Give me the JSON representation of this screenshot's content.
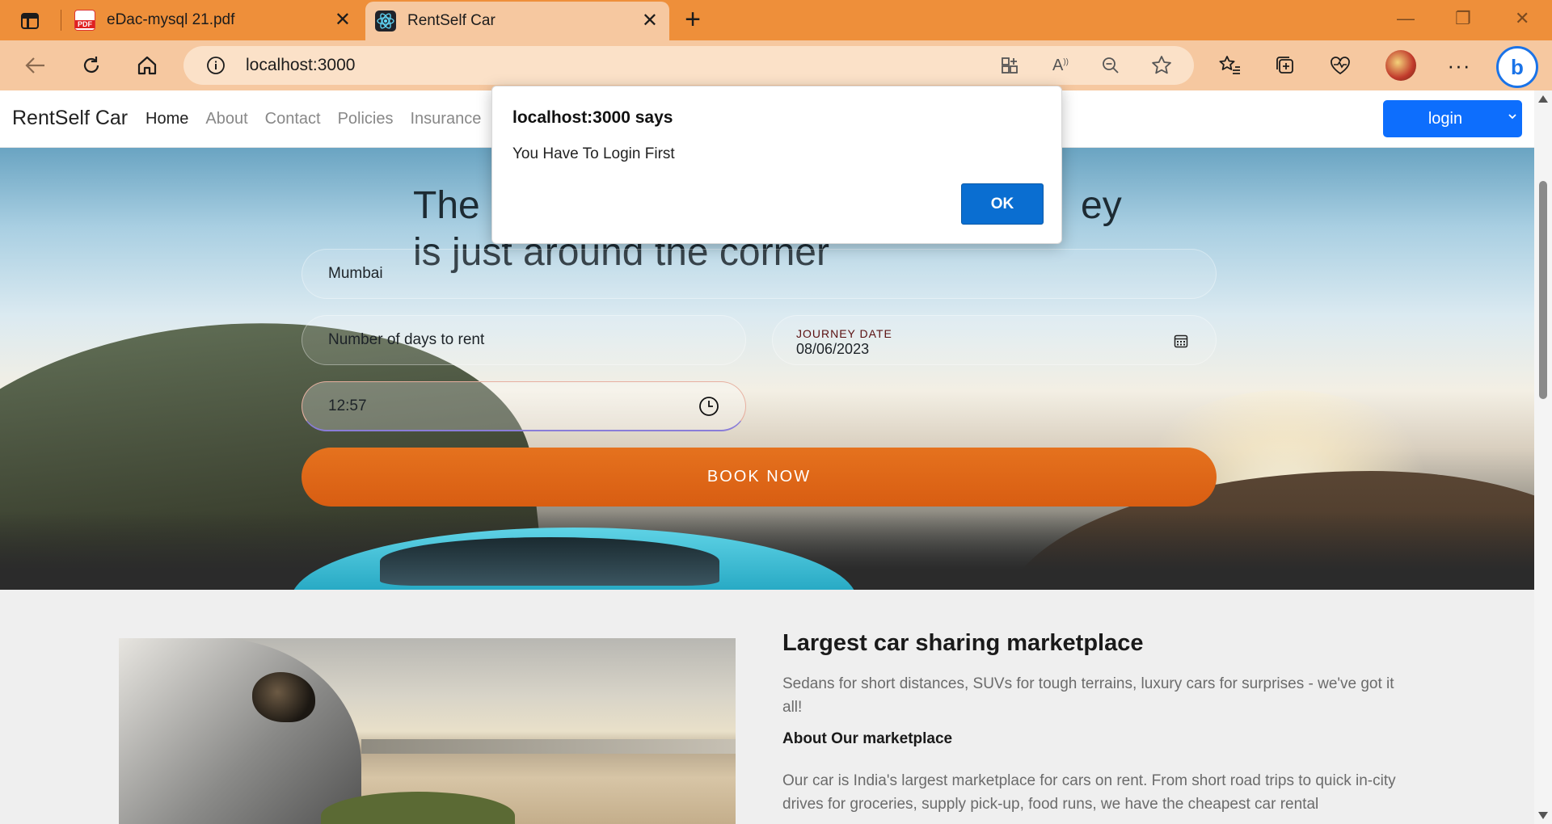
{
  "browser": {
    "tabs": [
      {
        "title": "eDac-mysql 21.pdf",
        "favicon": "pdf-icon",
        "active": false
      },
      {
        "title": "RentSelf Car",
        "favicon": "react-icon",
        "active": true
      }
    ],
    "address": "localhost:3000",
    "accent": "#ee8f3a",
    "toolbar_color": "#f6c8a0"
  },
  "site": {
    "brand": "RentSelf Car",
    "nav": [
      "Home",
      "About",
      "Contact",
      "Policies",
      "Insurance"
    ],
    "active_nav": "Home",
    "login_label": "login",
    "login_color": "#0d6efd"
  },
  "hero": {
    "title_line1": "The",
    "title_line1_tail": "ey",
    "title_line2": "is just around the corner",
    "city_value": "Mumbai",
    "days_placeholder": "Number of days to rent",
    "date_caption": "JOURNEY DATE",
    "date_value": "08/06/2023",
    "time_value": "12:57",
    "book_label": "BOOK NOW",
    "book_color": "#e06a18"
  },
  "marketplace": {
    "title": "Largest car sharing marketplace",
    "description": "Sedans for short distances, SUVs for tough terrains, luxury cars for surprises - we've got it all!",
    "subtitle": "About Our marketplace",
    "body": "Our car is India's largest marketplace for cars on rent. From short road trips to quick in-city drives for groceries, supply pick-up, food runs, we have the cheapest car rental"
  },
  "alert": {
    "title": "localhost:3000 says",
    "message": "You Have To Login First",
    "ok_label": "OK",
    "ok_color": "#0a6ed1"
  }
}
